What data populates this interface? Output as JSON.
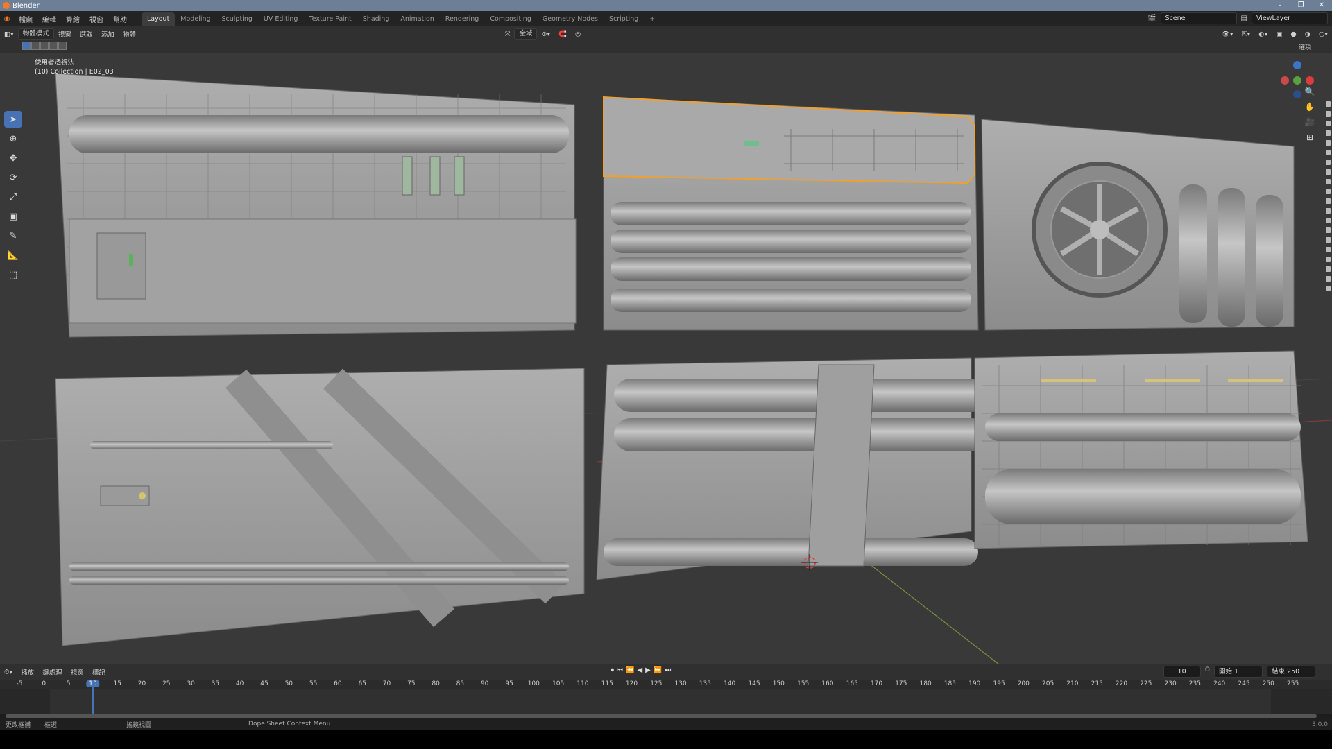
{
  "window": {
    "title": "Blender",
    "controls": [
      "–",
      "❐",
      "✕"
    ]
  },
  "menu": [
    "檔案",
    "編輯",
    "算繪",
    "視窗",
    "幫助"
  ],
  "workspaces": [
    "Layout",
    "Modeling",
    "Sculpting",
    "UV Editing",
    "Texture Paint",
    "Shading",
    "Animation",
    "Rendering",
    "Compositing",
    "Geometry Nodes",
    "Scripting",
    "+"
  ],
  "active_workspace": "Layout",
  "scene": {
    "label": "Scene",
    "viewlayer": "ViewLayer"
  },
  "viewport_header": {
    "mode": "物體模式",
    "menus": [
      "視窗",
      "選取",
      "添加",
      "物體"
    ],
    "transform": "全域",
    "options": "選項"
  },
  "overlay": {
    "line1": "使用者透視法",
    "line2": "(10) Collection | E02_03"
  },
  "tools": [
    "select",
    "cursor",
    "move",
    "rotate",
    "scale",
    "transform",
    "annotate",
    "measure",
    "add-cube"
  ],
  "timeline": {
    "menus": [
      "播放",
      "鍵處理",
      "視窗",
      "標記"
    ],
    "current_frame": "10",
    "start_label": "開始",
    "start": "1",
    "end_label": "結束",
    "end": "250"
  },
  "ruler": [
    "-5",
    "0",
    "5",
    "10",
    "15",
    "20",
    "25",
    "30",
    "35",
    "40",
    "45",
    "50",
    "55",
    "60",
    "65",
    "70",
    "75",
    "80",
    "85",
    "90",
    "95",
    "100",
    "105",
    "110",
    "115",
    "120",
    "125",
    "130",
    "135",
    "140",
    "145",
    "150",
    "155",
    "160",
    "165",
    "170",
    "175",
    "180",
    "185",
    "190",
    "195",
    "200",
    "205",
    "210",
    "215",
    "220",
    "225",
    "230",
    "235",
    "240",
    "245",
    "250",
    "255"
  ],
  "status": {
    "item1": "更改框補",
    "item2": "框選",
    "item3": "搖鏡視圖",
    "item4": "Dope Sheet Context Menu",
    "version": "3.0.0"
  }
}
